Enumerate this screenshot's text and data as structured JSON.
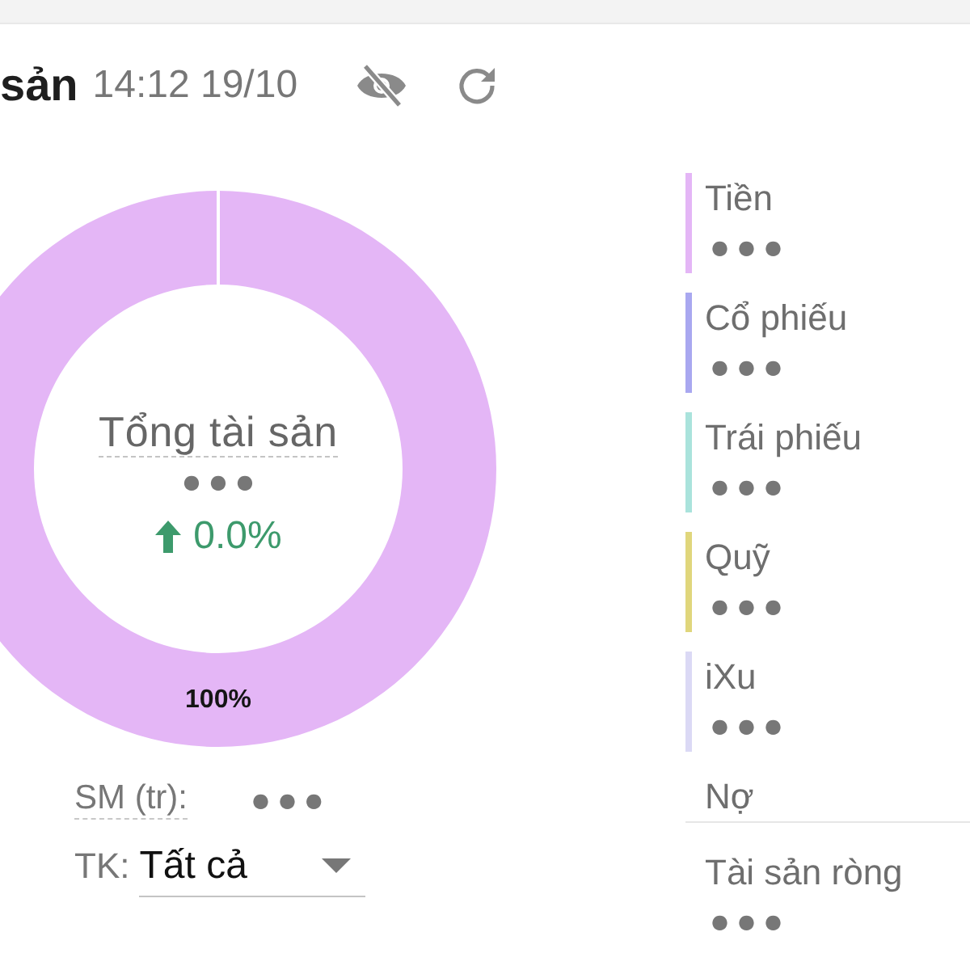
{
  "header": {
    "title": "sản",
    "time": "14:12 19/10",
    "values_hidden": true
  },
  "chart": {
    "ring_label": "100%",
    "center": {
      "title": "Tổng tài sản",
      "value": "●●●",
      "change": "0.0%"
    }
  },
  "filters": {
    "scale": {
      "label": "SM (tr):",
      "value": "●●●"
    },
    "account": {
      "label": "TK:",
      "value": "Tất cả"
    }
  },
  "legend": {
    "items": [
      {
        "label": "Tiền",
        "value": "●●●",
        "color": "#e4b6f6"
      },
      {
        "label": "Cổ phiếu",
        "value": "●●●",
        "color": "#a9a8f0"
      },
      {
        "label": "Trái phiếu",
        "value": "●●●",
        "color": "#aae3dc"
      },
      {
        "label": "Quỹ",
        "value": "●●●",
        "color": "#e0d67c"
      },
      {
        "label": "iXu",
        "value": "●●●",
        "color": "#dbd9f5"
      },
      {
        "label": "Nợ"
      }
    ],
    "total": {
      "label": "Tài sản ròng",
      "value": "●●●"
    }
  }
}
